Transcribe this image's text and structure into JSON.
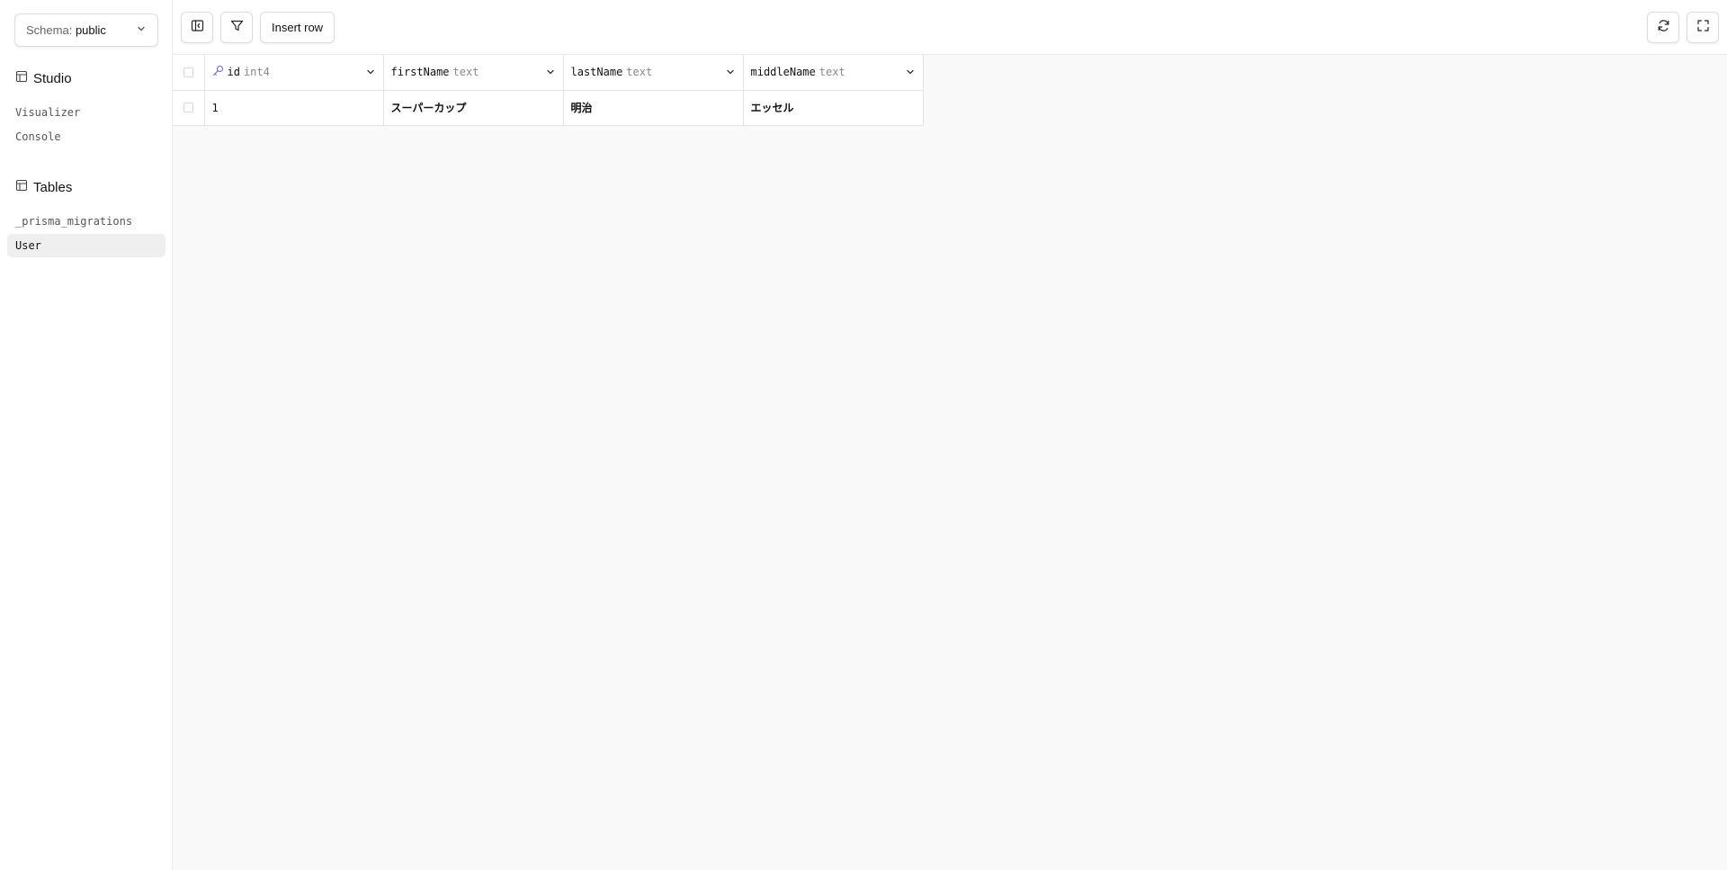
{
  "sidebar": {
    "schema": {
      "label": "Schema:",
      "value": "public"
    },
    "studio": {
      "title": "Studio",
      "items": [
        {
          "label": "Visualizer"
        },
        {
          "label": "Console"
        }
      ]
    },
    "tables": {
      "title": "Tables",
      "items": [
        {
          "label": "_prisma_migrations",
          "active": false
        },
        {
          "label": "User",
          "active": true
        }
      ]
    }
  },
  "toolbar": {
    "insert_row_label": "Insert row",
    "icons": {
      "toggle_sidebar": "sidebar-toggle-icon",
      "filter": "filter-icon",
      "refresh": "refresh-icon",
      "fullscreen": "fullscreen-icon"
    }
  },
  "table": {
    "columns": [
      {
        "name": "id",
        "type": "int4",
        "primary_key": true
      },
      {
        "name": "firstName",
        "type": "text"
      },
      {
        "name": "lastName",
        "type": "text"
      },
      {
        "name": "middleName",
        "type": "text"
      }
    ],
    "rows": [
      {
        "id": "1",
        "firstName": "スーパーカップ",
        "lastName": "明治",
        "middleName": "エッセル"
      }
    ]
  },
  "colors": {
    "accent_key": "#6b6bd6",
    "border": "#e4e4e4",
    "canvas": "#f9f9f9"
  }
}
